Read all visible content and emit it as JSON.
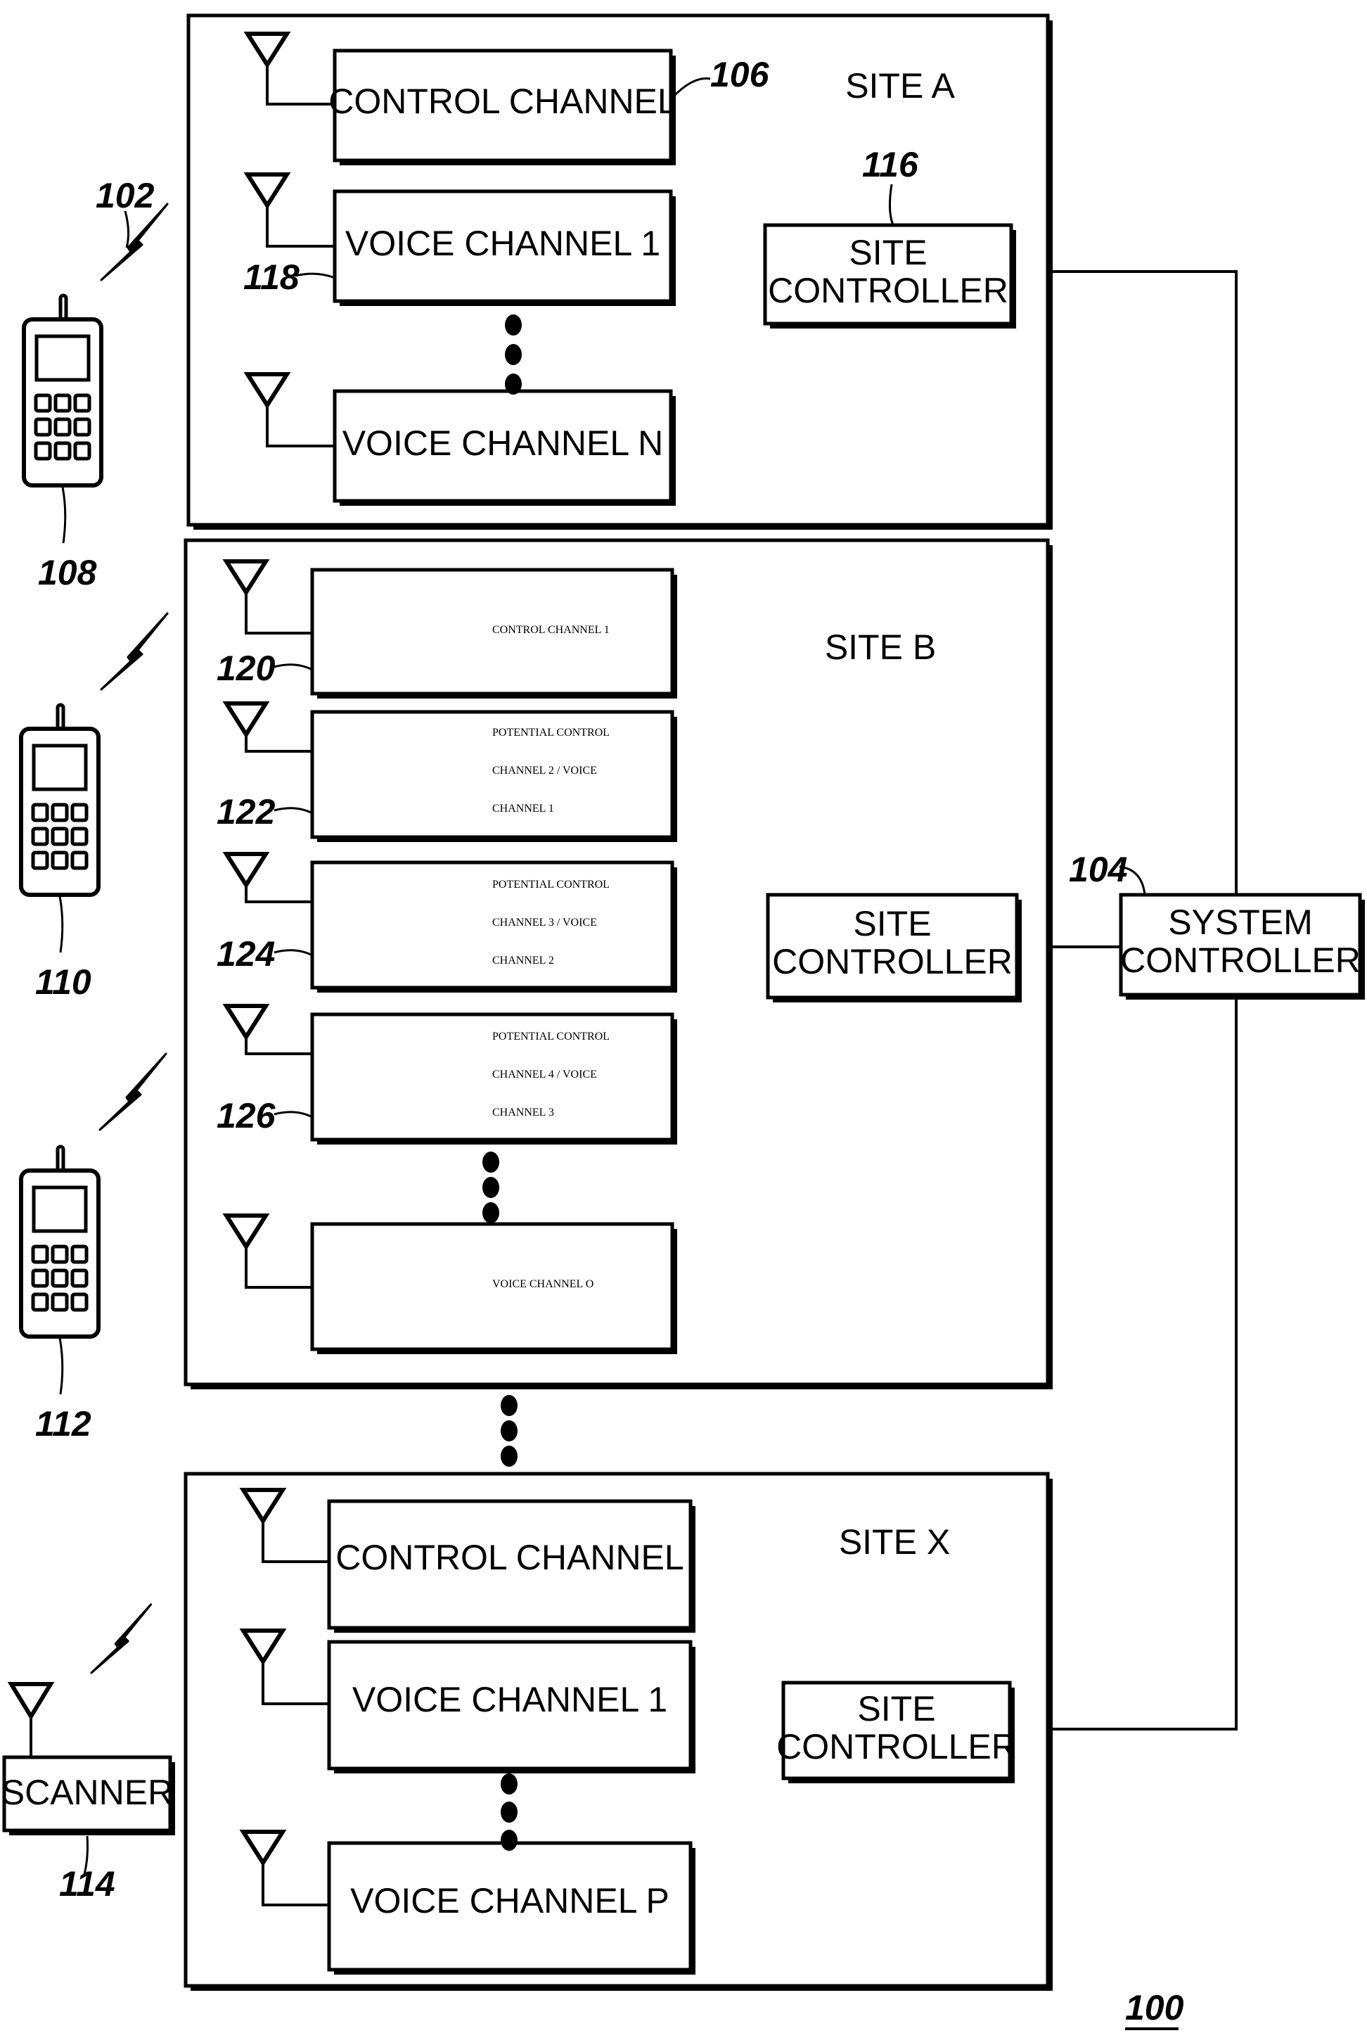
{
  "figure_number": "100",
  "colors": {
    "ink": "#000000",
    "paper": "#ffffff"
  },
  "sites": [
    {
      "id": "site-a",
      "label": "SITE A",
      "controller": {
        "lines": [
          "SITE",
          "CONTROLLER"
        ],
        "ref": "116"
      },
      "channels": [
        {
          "lines": [
            "CONTROL CHANNEL"
          ],
          "ref": "106"
        },
        {
          "lines": [
            "VOICE CHANNEL 1"
          ],
          "ref": "118"
        },
        {
          "lines": [
            "VOICE CHANNEL N"
          ],
          "ref": ""
        }
      ]
    },
    {
      "id": "site-b",
      "label": "SITE B",
      "controller": {
        "lines": [
          "SITE",
          "CONTROLLER"
        ],
        "ref": ""
      },
      "channels": [
        {
          "lines": [
            "CONTROL CHANNEL 1"
          ],
          "ref": "120"
        },
        {
          "lines": [
            "POTENTIAL CONTROL",
            "CHANNEL 2 / VOICE",
            "CHANNEL 1"
          ],
          "ref": "122"
        },
        {
          "lines": [
            "POTENTIAL CONTROL",
            "CHANNEL 3 / VOICE",
            "CHANNEL 2"
          ],
          "ref": "124"
        },
        {
          "lines": [
            "POTENTIAL CONTROL",
            "CHANNEL 4 / VOICE",
            "CHANNEL 3"
          ],
          "ref": "126"
        },
        {
          "lines": [
            "VOICE CHANNEL O"
          ],
          "ref": ""
        }
      ]
    },
    {
      "id": "site-x",
      "label": "SITE  X",
      "controller": {
        "lines": [
          "SITE",
          "CONTROLLER"
        ],
        "ref": ""
      },
      "channels": [
        {
          "lines": [
            "CONTROL CHANNEL"
          ],
          "ref": ""
        },
        {
          "lines": [
            "VOICE CHANNEL 1"
          ],
          "ref": ""
        },
        {
          "lines": [
            "VOICE CHANNEL P"
          ],
          "ref": ""
        }
      ]
    }
  ],
  "system_controller": {
    "lines": [
      "SYSTEM",
      "CONTROLLER"
    ],
    "ref": "104"
  },
  "subscribers": [
    {
      "type": "phone",
      "ref": "108",
      "link_ref": "102"
    },
    {
      "type": "phone",
      "ref": "110",
      "link_ref": ""
    },
    {
      "type": "phone",
      "ref": "112",
      "link_ref": ""
    },
    {
      "type": "scanner",
      "label": "SCANNER",
      "ref": "114",
      "link_ref": ""
    }
  ]
}
